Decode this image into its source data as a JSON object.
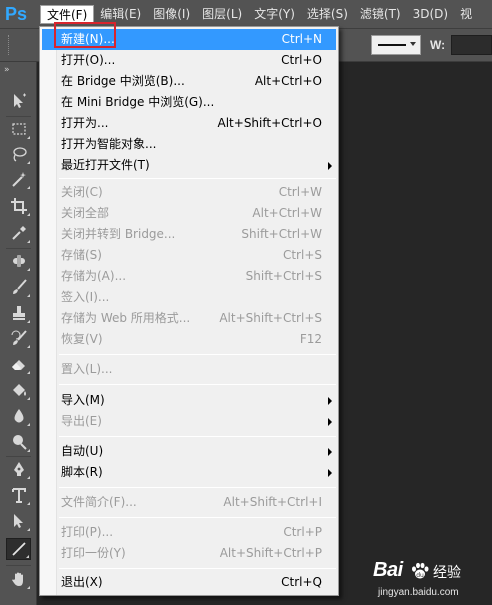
{
  "app": {
    "logo": "Ps"
  },
  "menubar": {
    "items": [
      {
        "label": "文件(F)",
        "active": true
      },
      {
        "label": "编辑(E)"
      },
      {
        "label": "图像(I)"
      },
      {
        "label": "图层(L)"
      },
      {
        "label": "文字(Y)"
      },
      {
        "label": "选择(S)"
      },
      {
        "label": "滤镜(T)"
      },
      {
        "label": "3D(D)"
      },
      {
        "label": "视"
      }
    ]
  },
  "options_bar": {
    "width_label": "W:"
  },
  "toolbar": {
    "collapse_glyph": "»",
    "tools": [
      {
        "icon": "move-tool-icon"
      },
      {
        "icon": "marquee-tool-icon"
      },
      {
        "icon": "lasso-tool-icon"
      },
      {
        "icon": "magic-wand-tool-icon"
      },
      {
        "icon": "crop-tool-icon"
      },
      {
        "icon": "eyedropper-tool-icon"
      },
      {
        "icon": "healing-brush-tool-icon"
      },
      {
        "icon": "brush-tool-icon"
      },
      {
        "icon": "clone-stamp-tool-icon"
      },
      {
        "icon": "history-brush-tool-icon"
      },
      {
        "icon": "eraser-tool-icon"
      },
      {
        "icon": "paint-bucket-tool-icon"
      },
      {
        "icon": "blur-tool-icon"
      },
      {
        "icon": "dodge-tool-icon"
      },
      {
        "icon": "pen-tool-icon"
      },
      {
        "icon": "type-tool-icon"
      },
      {
        "icon": "path-selection-tool-icon"
      },
      {
        "icon": "line-tool-icon",
        "selected": true
      },
      {
        "icon": "hand-tool-icon"
      }
    ]
  },
  "file_menu": {
    "entries": [
      {
        "label": "新建(N)...",
        "shortcut": "Ctrl+N",
        "enabled": true,
        "highlighted": true
      },
      {
        "label": "打开(O)...",
        "shortcut": "Ctrl+O",
        "enabled": true
      },
      {
        "label": "在 Bridge 中浏览(B)...",
        "shortcut": "Alt+Ctrl+O",
        "enabled": true
      },
      {
        "label": "在 Mini Bridge 中浏览(G)...",
        "shortcut": "",
        "enabled": true
      },
      {
        "label": "打开为...",
        "shortcut": "Alt+Shift+Ctrl+O",
        "enabled": true
      },
      {
        "label": "打开为智能对象...",
        "shortcut": "",
        "enabled": true
      },
      {
        "label": "最近打开文件(T)",
        "shortcut": "",
        "enabled": true,
        "submenu": true
      },
      {
        "label": "关闭(C)",
        "shortcut": "Ctrl+W",
        "enabled": false
      },
      {
        "label": "关闭全部",
        "shortcut": "Alt+Ctrl+W",
        "enabled": false
      },
      {
        "label": "关闭并转到 Bridge...",
        "shortcut": "Shift+Ctrl+W",
        "enabled": false
      },
      {
        "label": "存储(S)",
        "shortcut": "Ctrl+S",
        "enabled": false
      },
      {
        "label": "存储为(A)...",
        "shortcut": "Shift+Ctrl+S",
        "enabled": false
      },
      {
        "label": "签入(I)...",
        "shortcut": "",
        "enabled": false
      },
      {
        "label": "存储为 Web 所用格式...",
        "shortcut": "Alt+Shift+Ctrl+S",
        "enabled": false
      },
      {
        "label": "恢复(V)",
        "shortcut": "F12",
        "enabled": false
      },
      {
        "label": "置入(L)...",
        "shortcut": "",
        "enabled": false
      },
      {
        "label": "导入(M)",
        "shortcut": "",
        "enabled": true,
        "submenu": true
      },
      {
        "label": "导出(E)",
        "shortcut": "",
        "enabled": false,
        "submenu": true
      },
      {
        "label": "自动(U)",
        "shortcut": "",
        "enabled": true,
        "submenu": true
      },
      {
        "label": "脚本(R)",
        "shortcut": "",
        "enabled": true,
        "submenu": true
      },
      {
        "label": "文件简介(F)...",
        "shortcut": "Alt+Shift+Ctrl+I",
        "enabled": false
      },
      {
        "label": "打印(P)...",
        "shortcut": "Ctrl+P",
        "enabled": false
      },
      {
        "label": "打印一份(Y)",
        "shortcut": "Alt+Shift+Ctrl+P",
        "enabled": false
      },
      {
        "label": "退出(X)",
        "shortcut": "Ctrl+Q",
        "enabled": true
      }
    ]
  },
  "watermark": {
    "brand": "Bai",
    "product": "经验",
    "url": "jingyan.baidu.com"
  },
  "colors": {
    "highlight": "#3399ff",
    "annotation_box": "#d9252e",
    "ps_blue": "#31a8ff"
  }
}
